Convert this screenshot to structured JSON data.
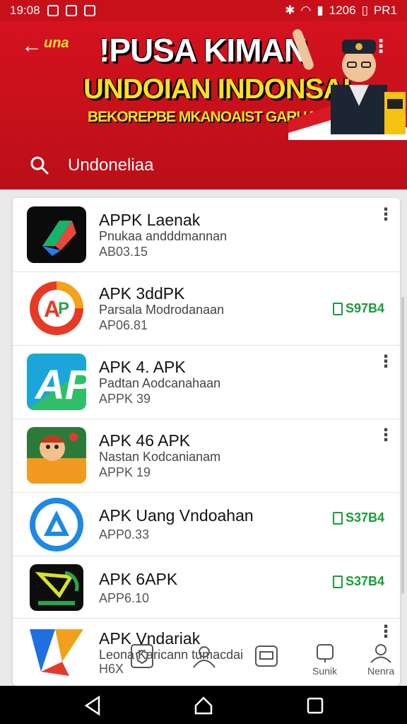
{
  "status_bar": {
    "time": "19:08",
    "battery_time": "1206",
    "extra": "PR1"
  },
  "header": {
    "brand": "una",
    "headline_line1": "!PUSA KIMAN",
    "headline_line2": "UNDOIAN INDONSAI",
    "headline_line3": "BEKOREPBE MKANOAIST GARUAI",
    "search_text": "Undoneliaa"
  },
  "apps": [
    {
      "name": "APPK Laenak",
      "developer": "Pnukaa andddmannan",
      "version": "AB03.15",
      "action": "more",
      "price": ""
    },
    {
      "name": "APK 3ddPK",
      "developer": "Parsala Modrodanaan",
      "version": "AP06.81",
      "action": "price",
      "price": "S97B4"
    },
    {
      "name": "APK 4. APK",
      "developer": "Padtan Aodcanahaan",
      "version": "APPK 39",
      "action": "more",
      "price": ""
    },
    {
      "name": "APK 46 APK",
      "developer": "Nastan Kodcanianam",
      "version": "APPK 19",
      "action": "more",
      "price": ""
    },
    {
      "name": "APK Uang Vndoahan",
      "developer": "",
      "version": "APP0.33",
      "action": "price",
      "price": "S37B4"
    },
    {
      "name": "APK 6APK",
      "developer": "",
      "version": "APP6.10",
      "action": "price",
      "price": "S37B4"
    },
    {
      "name": "APK Vndariak",
      "developer": "Leona Karicann tumacdai",
      "version": "H6X",
      "action": "more",
      "price": ""
    }
  ],
  "tab_bar": {
    "tab4_label": "Sunik",
    "tab5_label": "Nenra"
  },
  "colors": {
    "header_red": "#c8101b",
    "price_green": "#1b9a3a",
    "accent_yellow": "#ffe020"
  }
}
